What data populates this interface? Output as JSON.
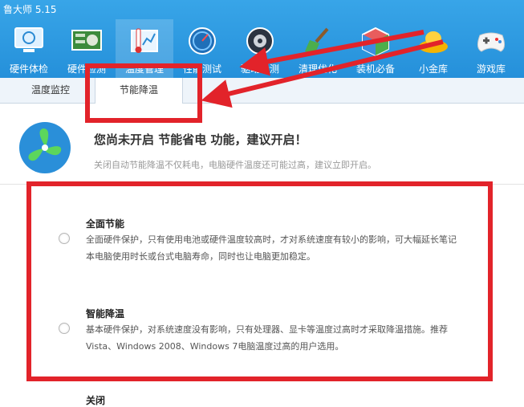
{
  "window": {
    "title": "鲁大师 5.15"
  },
  "toolbar": {
    "items": [
      {
        "label": "硬件体检",
        "icon": "monitor-icon"
      },
      {
        "label": "硬件检测",
        "icon": "circuit-board-icon"
      },
      {
        "label": "温度管理",
        "icon": "thermometer-icon",
        "active": true
      },
      {
        "label": "性能测试",
        "icon": "speedometer-icon"
      },
      {
        "label": "驱动检测",
        "icon": "gear-disk-icon"
      },
      {
        "label": "清理优化",
        "icon": "broom-icon"
      },
      {
        "label": "装机必备",
        "icon": "package-icon"
      },
      {
        "label": "小金库",
        "icon": "gold-ingot-icon"
      },
      {
        "label": "游戏库",
        "icon": "gamepad-icon"
      }
    ]
  },
  "subtabs": [
    {
      "label": "温度监控"
    },
    {
      "label": "节能降温",
      "active": true
    }
  ],
  "notice": {
    "icon": "fan-icon",
    "title": "您尚未开启 节能省电 功能，建议开启！",
    "subtitle": "关闭自动节能降温不仅耗电，电脑硬件温度还可能过高，建议立即开启。"
  },
  "options": [
    {
      "title": "全面节能",
      "description": "全面硬件保护，只有使用电池或硬件温度较高时，才对系统速度有较小的影响，可大幅延长笔记本电脑使用时长或台式电脑寿命，同时也让电脑更加稳定。",
      "selected": false
    },
    {
      "title": "智能降温",
      "description": "基本硬件保护，对系统速度没有影响，只有处理器、显卡等温度过高时才采取降温措施。推荐Vista、Windows 2008、Windows 7电脑温度过高的用户选用。",
      "selected": false
    },
    {
      "title": "关闭",
      "selected": false
    }
  ],
  "annotation_color": "#e2232a"
}
